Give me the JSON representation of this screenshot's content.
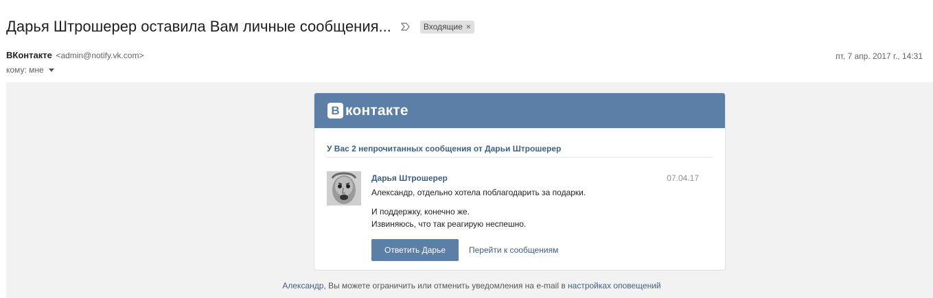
{
  "subject": "Дарья Штрошерер оставила Вам личные сообщения...",
  "label": {
    "name": "Входящие",
    "remove": "×"
  },
  "sender": {
    "name": "ВКонтакте",
    "email": "<admin@notify.vk.com>"
  },
  "date": "пт, 7 апр. 2017 г., 14:31",
  "recipient": "кому: мне",
  "vk": {
    "logo_letter": "В",
    "logo_text": "контакте",
    "brand_color": "#5b7fa6",
    "notice": "У Вас 2 непрочитанных сообщения от Дарьи Штрошерер",
    "message": {
      "author": "Дарья Штрошерер",
      "date": "07.04.17",
      "lines": [
        "Александр, отдельно хотела поблагодарить за подарки.",
        "И поддержку, конечно же.",
        "Извиняюсь, что так реагирую неспешно."
      ]
    },
    "reply_button": "Ответить Дарье",
    "goto_link": "Перейти к сообщениям"
  },
  "footer": {
    "name_link": "Александр",
    "text": ", Вы можете ограничить или отменить уведомления на e-mail в ",
    "settings_link": "настройках оповещений"
  },
  "icons": {
    "importance": "importance-marker-icon",
    "caret": "chevron-down-icon",
    "remove": "close-icon"
  }
}
